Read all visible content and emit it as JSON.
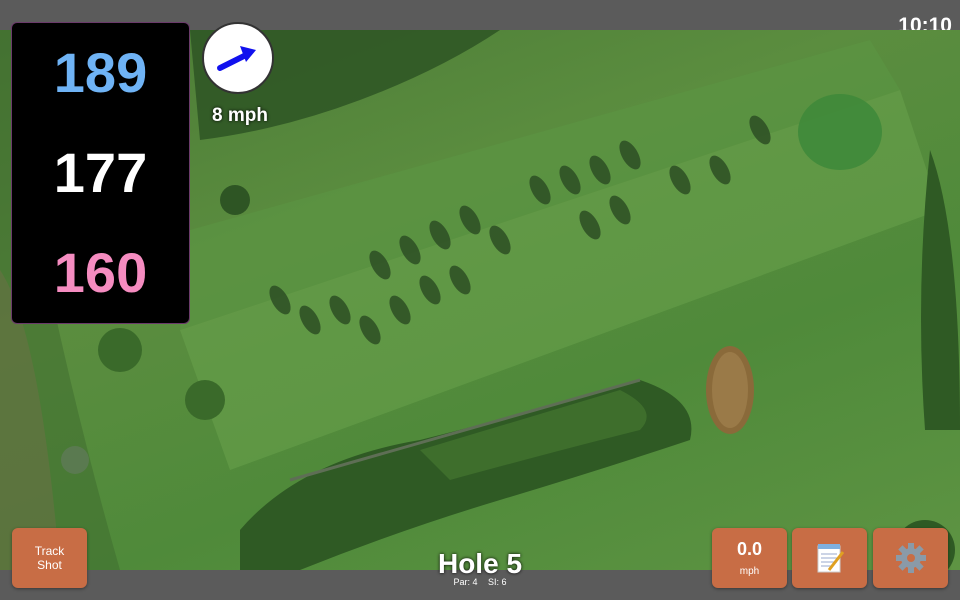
{
  "status": {
    "time": "10:10"
  },
  "yardages": {
    "back": "189",
    "middle": "177",
    "front": "160",
    "colors": {
      "back": "#6fb3f5",
      "middle": "#ffffff",
      "front": "#f58cc0"
    }
  },
  "wind": {
    "speed": "8 mph",
    "direction_icon": "arrow-right-up",
    "arrow_color": "#1111ee"
  },
  "hole": {
    "title": "Hole 5",
    "par": "Par: 4",
    "si": "SI: 6"
  },
  "buttons": {
    "track_shot": "Track Shot",
    "speed_value": "0.0",
    "speed_unit": "mph",
    "notes_icon": "notepad-icon",
    "settings_icon": "gear-icon",
    "accent": "#c86d45"
  }
}
